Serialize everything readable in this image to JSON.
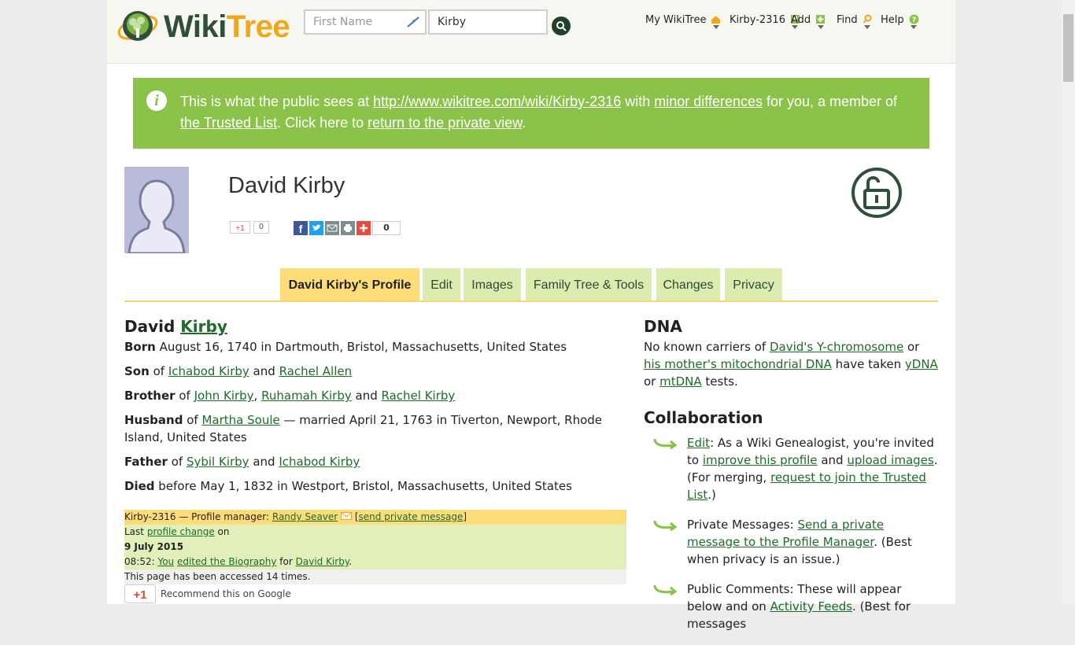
{
  "header": {
    "logo_wiki": "Wiki",
    "logo_tree": "Tree",
    "first_name_placeholder": "First Name",
    "last_name_value": "Kirby",
    "nav": [
      {
        "label": "My WikiTree",
        "icon": "home-icon"
      },
      {
        "label": "Kirby-2316",
        "icon": "profile-icon"
      },
      {
        "label": "Add",
        "icon": "plus-icon"
      },
      {
        "label": "Find",
        "icon": "search-icon"
      },
      {
        "label": "Help",
        "icon": "help-icon"
      }
    ]
  },
  "banner": {
    "t1": "This is what the public sees at ",
    "link_url": "http://www.wikitree.com/wiki/Kirby-2316",
    "t2": " with ",
    "link_minor": "minor differences",
    "t3": " for you, a member of ",
    "link_trusted": "the Trusted List",
    "t4": ". Click here to ",
    "link_private": "return to the private view",
    "t5": "."
  },
  "profile": {
    "name": "David Kirby",
    "gplus_label": "+1",
    "gplus_count": "0",
    "share_count": "0"
  },
  "tabs": [
    "David Kirby's Profile",
    "Edit",
    "Images",
    "Family Tree & Tools",
    "Changes",
    "Privacy"
  ],
  "bio": {
    "first": "David",
    "surname": "Kirby",
    "born_label": "Born",
    "born_text": "August 16, 1740 in Dartmouth, Bristol, Massachusetts, United States",
    "son_label": "Son",
    "of": "of",
    "and": "and",
    "father_name": "Ichabod Kirby",
    "mother_name": "Rachel Allen",
    "brother_label": "Brother",
    "siblings": [
      "John Kirby",
      "Ruhamah Kirby",
      "Rachel Kirby"
    ],
    "comma": ",",
    "husband_label": "Husband",
    "spouse": "Martha Soule",
    "married_text": "— married April 21, 1763 in Tiverton, Newport, Rhode Island, United States",
    "father_label": "Father",
    "children": [
      "Sybil Kirby",
      "Ichabod Kirby"
    ],
    "died_label": "Died",
    "died_text": "before May 1, 1832 in Westport, Bristol, Massachusetts, United States"
  },
  "manager": {
    "id_text": "Kirby-2316 — Profile manager:",
    "manager_name": "Randy Seaver",
    "send_pm": "send private message",
    "last": "Last",
    "profile_change": "profile change",
    "on": "on",
    "date": "9 July 2015",
    "time": "08:52:",
    "you": "You",
    "edited": "edited the Biography",
    "for": "for",
    "for_name": "David Kirby",
    "period": ".",
    "accessed": "This page has been accessed 14 times.",
    "recommend": "Recommend this on Google"
  },
  "dna": {
    "title": "DNA",
    "t1": "No known carriers of ",
    "link_y": "David's Y-chromosome",
    "t2": " or ",
    "link_mt": "his mother's mitochondrial DNA",
    "t3": " have taken ",
    "link_ydna": "yDNA",
    "t4": " or ",
    "link_mtdna": "mtDNA",
    "t5": " tests."
  },
  "collab": {
    "title": "Collaboration",
    "i1_link": "Edit",
    "i1_t1": ": As a Wiki Genealogist, you're invited to ",
    "i1_link2": "improve this profile",
    "i1_t2": " and ",
    "i1_link3": "upload images",
    "i1_t3": ". (For merging, ",
    "i1_link4": "request to join the Trusted List",
    "i1_t4": ".)",
    "i2_t1": "Private Messages: ",
    "i2_link": "Send a private message to the Profile Manager",
    "i2_t2": ". (Best when privacy is an issue.)",
    "i3_t1": "Public Comments: These will appear below and on ",
    "i3_link": "Activity Feeds",
    "i3_t2": ". (Best for messages"
  }
}
